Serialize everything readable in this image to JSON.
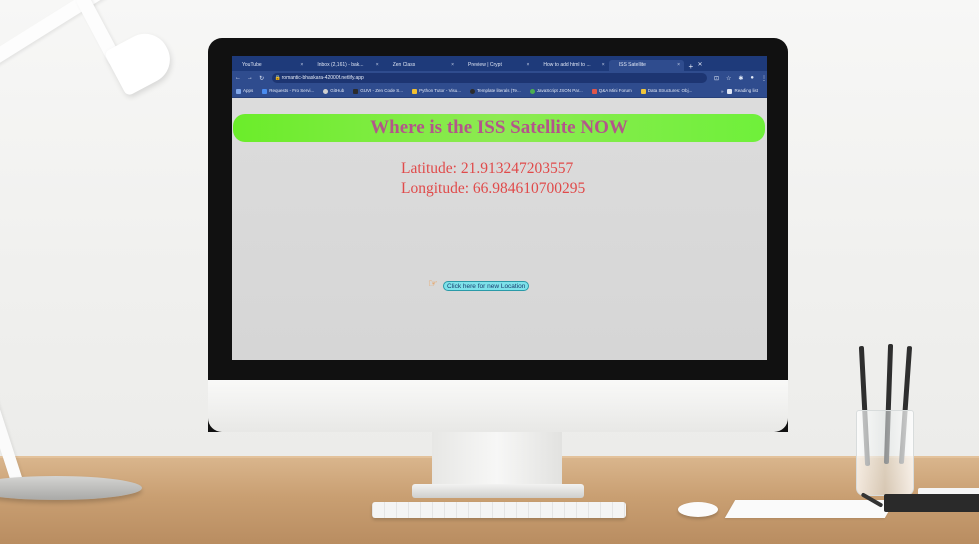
{
  "browser": {
    "tabs": [
      {
        "label": "YouTube"
      },
      {
        "label": "Inbox (2,161) - bak..."
      },
      {
        "label": "Zen Class"
      },
      {
        "label": "Preview | Crypt"
      },
      {
        "label": "How to add html to ..."
      },
      {
        "label": "ISS Satellite"
      }
    ],
    "new_tab": "+",
    "url": "romantic-bhaskara-42000f.netlify.app",
    "bookmarks": [
      {
        "label": "Apps",
        "color": "#7fa6e8"
      },
      {
        "label": "Requests - Fro Servi...",
        "color": "#4a8cf0"
      },
      {
        "label": "GitHub",
        "color": "#d0d0d0"
      },
      {
        "label": "GUVI - Zen Code S...",
        "color": "#2c2c2c"
      },
      {
        "label": "Python Tutor - Visu...",
        "color": "#f2c030"
      },
      {
        "label": "Template literals (Te...",
        "color": "#2c2c2c"
      },
      {
        "label": "JavaScript JSON Par...",
        "color": "#4caf50"
      },
      {
        "label": "Q&A Mini Forum",
        "color": "#e0564a"
      },
      {
        "label": "Data Structures: Obj...",
        "color": "#f0c53a"
      }
    ],
    "reading_list": "Reading list"
  },
  "page": {
    "title": "Where is the ISS Satellite NOW",
    "latitude": "Latitude: 21.913247203557",
    "longitude": "Longitude: 66.984610700295",
    "new_location_button": "Click here for new Location",
    "banner_color": "#7cf03e",
    "title_color": "#b3568a",
    "coord_color": "#e04a4a"
  }
}
